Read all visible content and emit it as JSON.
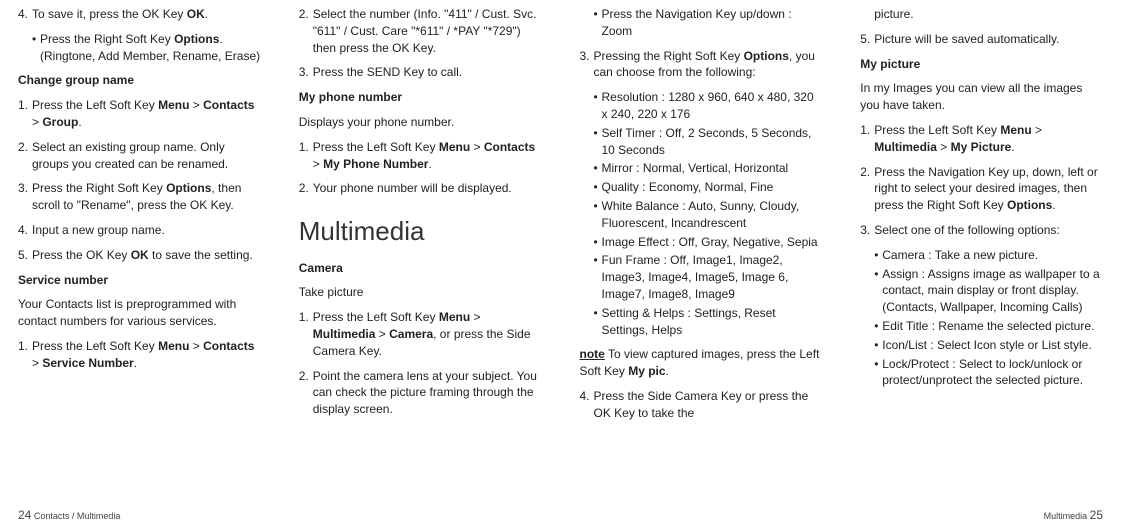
{
  "col1": {
    "l1_num": "4.",
    "l1_txt_a": "To save it, press the OK Key ",
    "l1_txt_b": "OK",
    "l1_txt_c": ".",
    "l1b_a": "Press the Right Soft Key ",
    "l1b_b": "Options",
    "l1b_c": ". (Ringtone, Add Member, Rename, Erase)",
    "h1": "Change group name",
    "g1_num": "1.",
    "g1_a": "Press the Left Soft Key ",
    "g1_b": "Menu",
    "g1_c": " > ",
    "g1_d": "Contacts",
    "g1_e": " > ",
    "g1_f": "Group",
    "g1_g": ".",
    "g2_num": "2.",
    "g2_txt": "Select an existing group name. Only groups you created can be renamed.",
    "g3_num": "3.",
    "g3_a": "Press the Right Soft Key ",
    "g3_b": "Options",
    "g3_c": ", then scroll to \"Rename\", press the OK Key.",
    "g4_num": "4.",
    "g4_txt": "Input a new group name.",
    "g5_num": "5.",
    "g5_a": "Press the OK Key ",
    "g5_b": "OK",
    "g5_c": " to save the setting.",
    "h2": "Service number",
    "p1": "Your Contacts list is preprogrammed with contact numbers for various services.",
    "s1_num": "1.",
    "s1_a": "Press the Left Soft Key ",
    "s1_b": "Menu",
    "s1_c": " > ",
    "s1_d": "Contacts",
    "s1_e": " > ",
    "s1_f": "Service Number",
    "s1_g": "."
  },
  "col2": {
    "s2_num": "2.",
    "s2_txt": "Select the number (Info. \"411\" / Cust. Svc. \"611\" / Cust. Care \"*611\" / *PAY \"*729\") then press the OK Key.",
    "s3_num": "3.",
    "s3_txt": "Press the SEND Key to call.",
    "h1": "My phone number",
    "p1": "Displays your phone number.",
    "m1_num": "1.",
    "m1_a": "Press the Left Soft Key ",
    "m1_b": "Menu",
    "m1_c": " > ",
    "m1_d": "Contacts",
    "m1_e": " > ",
    "m1_f": "My Phone Number",
    "m1_g": ".",
    "m2_num": "2.",
    "m2_txt": "Your phone number will be displayed.",
    "bigh": "Multimedia",
    "h2": "Camera",
    "sh1": "Take picture",
    "c1_num": "1.",
    "c1_a": "Press the Left Soft Key ",
    "c1_b": "Menu",
    "c1_c": " > ",
    "c1_d": "Multimedia",
    "c1_e": " > ",
    "c1_f": "Camera",
    "c1_g": ", or press the Side Camera Key.",
    "c2_num": "2.",
    "c2_txt": "Point the camera lens at your subject. You can check the picture framing through the display screen."
  },
  "col3": {
    "b1": "Press the Navigation Key up/down : Zoom",
    "r3_num": "3.",
    "r3_a": "Pressing the Right Soft Key ",
    "r3_b": "Options",
    "r3_c": ", you can choose from the following:",
    "opt1": "Resolution : 1280 x 960, 640 x 480, 320 x 240, 220 x 176",
    "opt2": "Self Timer : Off, 2 Seconds, 5 Seconds, 10 Seconds",
    "opt3": "Mirror : Normal, Vertical, Horizontal",
    "opt4": "Quality : Economy, Normal, Fine",
    "opt5": "White Balance : Auto, Sunny, Cloudy, Fluorescent, Incandrescent",
    "opt6": "Image Effect : Off, Gray, Negative, Sepia",
    "opt7": "Fun Frame : Off, Image1, Image2, Image3, Image4, Image5, Image 6, Image7, Image8, Image9",
    "opt8": "Setting & Helps : Settings, Reset Settings, Helps",
    "note_label": "note",
    "note_a": " To view captured images, press the Left Soft Key ",
    "note_b": "My pic",
    "note_c": ".",
    "r4_num": "4.",
    "r4_txt": "Press the Side Camera Key or press the OK Key to take the"
  },
  "col4": {
    "cont": "picture.",
    "r5_num": "5.",
    "r5_txt": "Picture will be saved automatically.",
    "h1": "My picture",
    "p1": "In my Images you can view all the images you have taken.",
    "p1_num": "1.",
    "p1_a": "Press the Left Soft Key ",
    "p1_b": "Menu",
    "p1_c": " > ",
    "p1_d": "Multimedia",
    "p1_e": " > ",
    "p1_f": "My Picture",
    "p1_g": ".",
    "p2_num": "2.",
    "p2_a": "Press the Navigation Key up, down, left or right to select your desired images, then press the Right Soft Key ",
    "p2_b": "Options",
    "p2_c": ".",
    "p3_num": "3.",
    "p3_txt": "Select one of the following options:",
    "opt1": "Camera : Take a new picture.",
    "opt2": "Assign : Assigns image as wallpaper to a contact, main display or front display. (Contacts, Wallpaper, Incoming Calls)",
    "opt3": "Edit Title : Rename the selected picture.",
    "opt4": "Icon/List : Select Icon style or List style.",
    "opt5": "Lock/Protect : Select to lock/unlock or protect/unprotect the selected picture."
  },
  "footer": {
    "left_num": "24",
    "left_txt": "Contacts / Multimedia",
    "right_txt": "Multimedia",
    "right_num": "25"
  }
}
